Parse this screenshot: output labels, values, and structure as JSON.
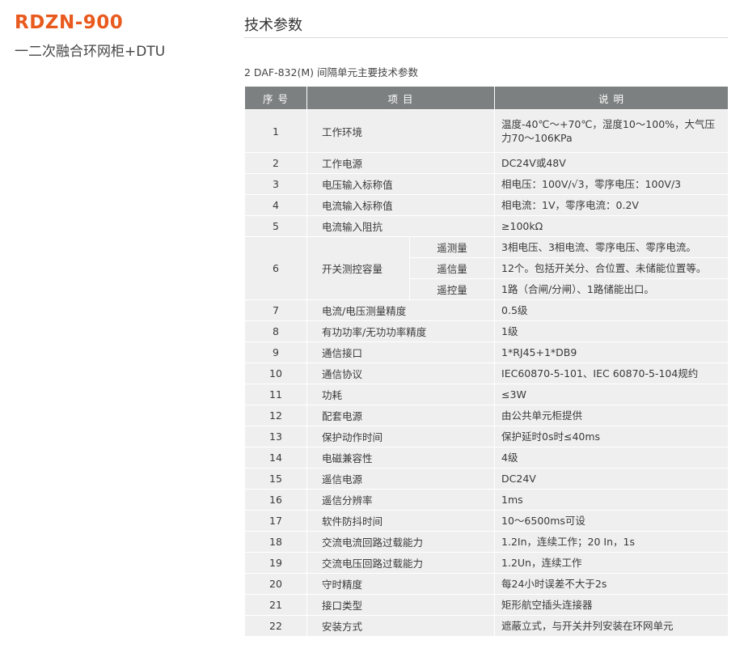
{
  "product": {
    "name": "RDZN-900",
    "subtitle": "一二次融合环网柜+DTU"
  },
  "section": {
    "title": "技术参数",
    "caption": "2 DAF-832(M) 间隔单元主要技术参数"
  },
  "table": {
    "headers": {
      "no": "序 号",
      "item": "项 目",
      "desc": "说 明"
    },
    "rows": [
      {
        "no": "1",
        "item": "工作环境",
        "desc": "温度-40℃～+70℃，湿度10～100%，大气压力70～106KPa"
      },
      {
        "no": "2",
        "item": "工作电源",
        "desc": "DC24V或48V"
      },
      {
        "no": "3",
        "item": "电压输入标称值",
        "desc": "相电压：100V/√3，零序电压：100V/3"
      },
      {
        "no": "4",
        "item": "电流输入标称值",
        "desc": "相电流：1V，零序电流：0.2V"
      },
      {
        "no": "5",
        "item": "电流输入阻抗",
        "desc": "≥100kΩ"
      },
      {
        "no": "6",
        "item": "开关测控容量",
        "subs": [
          {
            "name": "遥测量",
            "desc": "3相电压、3相电流、零序电压、零序电流。"
          },
          {
            "name": "遥信量",
            "desc": "12个。包括开关分、合位置、未储能位置等。"
          },
          {
            "name": "遥控量",
            "desc": "1路（合闸/分闸）、1路储能出口。"
          }
        ]
      },
      {
        "no": "7",
        "item": "电流/电压测量精度",
        "desc": "0.5级"
      },
      {
        "no": "8",
        "item": "有功功率/无功功率精度",
        "desc": "1级"
      },
      {
        "no": "9",
        "item": "通信接口",
        "desc": "1*RJ45+1*DB9"
      },
      {
        "no": "10",
        "item": "通信协议",
        "desc": "IEC60870-5-101、IEC 60870-5-104规约"
      },
      {
        "no": "11",
        "item": "功耗",
        "desc": "≤3W"
      },
      {
        "no": "12",
        "item": "配套电源",
        "desc": "由公共单元柜提供"
      },
      {
        "no": "13",
        "item": "保护动作时间",
        "desc": "保护延时0s时≤40ms"
      },
      {
        "no": "14",
        "item": "电磁兼容性",
        "desc": "4级"
      },
      {
        "no": "15",
        "item": "遥信电源",
        "desc": "DC24V"
      },
      {
        "no": "16",
        "item": "遥信分辨率",
        "desc": "1ms"
      },
      {
        "no": "17",
        "item": "软件防抖时间",
        "desc": "10～6500ms可设"
      },
      {
        "no": "18",
        "item": "交流电流回路过载能力",
        "desc": "1.2In，连续工作；20 In，1s"
      },
      {
        "no": "19",
        "item": "交流电压回路过载能力",
        "desc": "1.2Un，连续工作"
      },
      {
        "no": "20",
        "item": "守时精度",
        "desc": "每24小时误差不大于2s"
      },
      {
        "no": "21",
        "item": "接口类型",
        "desc": "矩形航空插头连接器"
      },
      {
        "no": "22",
        "item": "安装方式",
        "desc": "遮蔽立式，与开关并列安装在环网单元"
      }
    ]
  },
  "colors": {
    "brand_orange": "#e85a1e",
    "header_gray": "#7d8080",
    "row_gray": "#efefef"
  }
}
